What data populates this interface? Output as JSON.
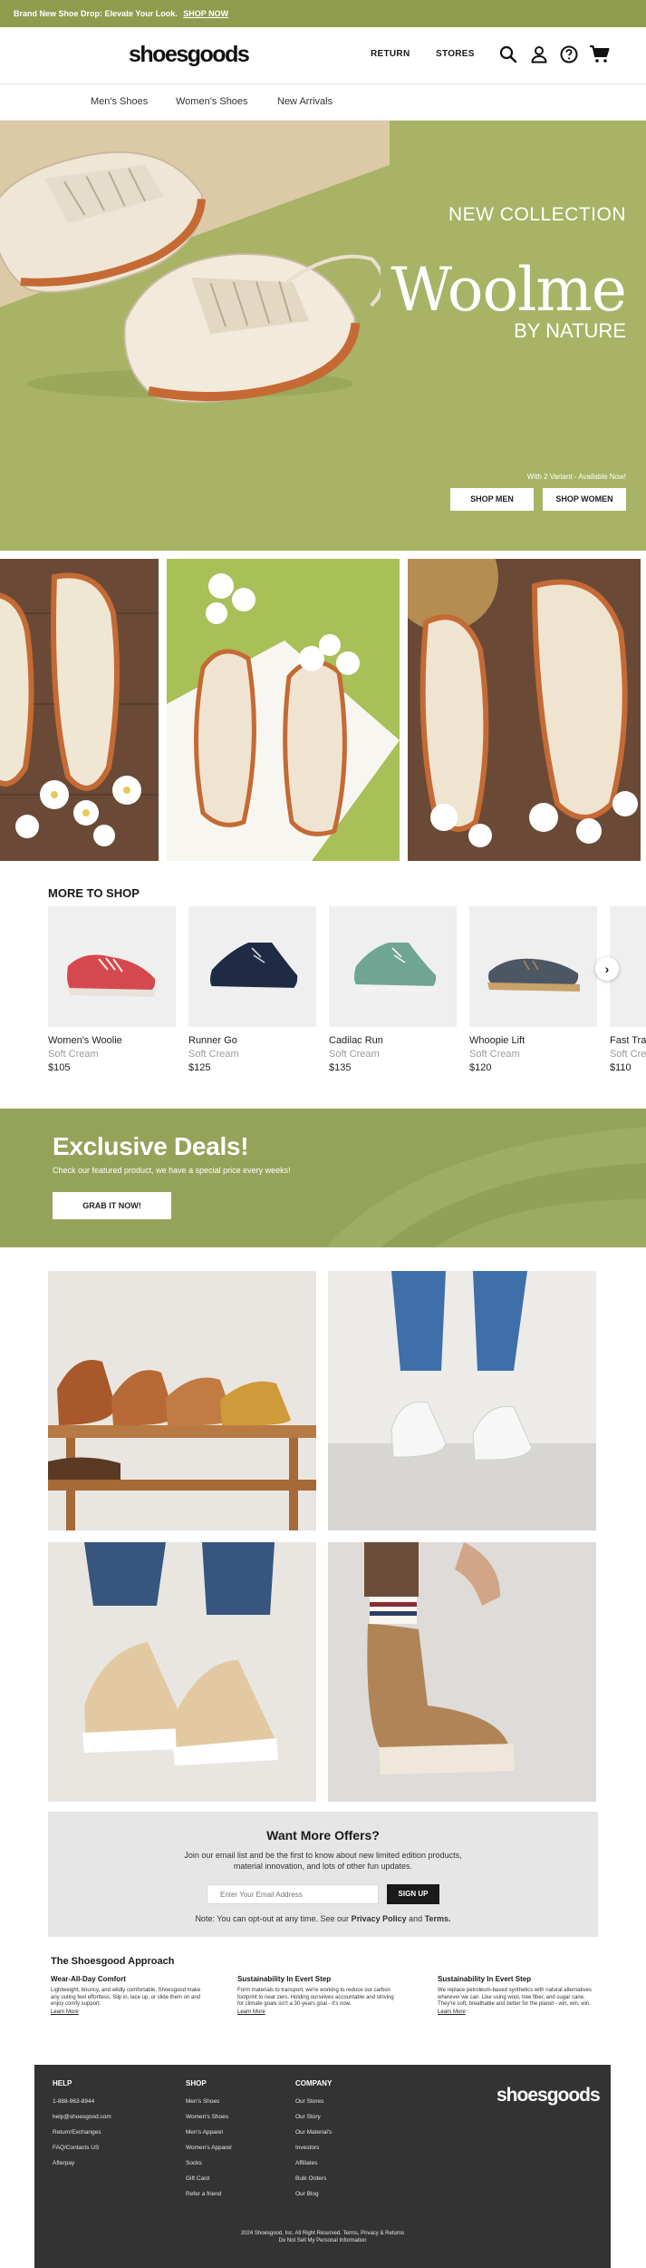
{
  "announcement": {
    "text": "Brand New Shoe Drop: Elevate Your Look.",
    "link": "SHOP NOW"
  },
  "header": {
    "logo": "shoesgoods",
    "nav": [
      "RETURN",
      "STORES"
    ],
    "icons": [
      "search-icon",
      "account-icon",
      "help-icon",
      "cart-icon"
    ]
  },
  "subnav": {
    "items": [
      "Men's Shoes",
      "Women's Shoes",
      "New Arrivals"
    ]
  },
  "hero": {
    "kicker": "NEW COLLECTION",
    "title": "Woolme",
    "subtitle": "BY NATURE",
    "variant_note": "With 2 Variant - Available Now!",
    "buttons": [
      "SHOP MEN",
      "SHOP WOMEN"
    ],
    "bg_color": "#a8b366"
  },
  "more_to_shop": {
    "title": "MORE TO SHOP",
    "products": [
      {
        "name": "Women's Woolie",
        "color": "Soft Cream",
        "price": "$105"
      },
      {
        "name": "Runner Go",
        "color": "Soft Cream",
        "price": "$125"
      },
      {
        "name": "Cadilac Run",
        "color": "Soft Cream",
        "price": "$135"
      },
      {
        "name": "Whoopie Lift",
        "color": "Soft Cream",
        "price": "$120"
      },
      {
        "name": "Fast Trai",
        "color": "Soft Cre",
        "price": "$110"
      }
    ]
  },
  "deals": {
    "title": "Exclusive Deals!",
    "subtitle": "Check our featured product, we have a special price every weeks!",
    "button": "GRAB IT NOW!"
  },
  "newsletter": {
    "title": "Want More Offers?",
    "description": "Join our email list and be the first to know about new limited edition products, material innovation, and lots of other fun updates.",
    "placeholder": "Enter Your Email Address",
    "button": "SIGN UP",
    "note_prefix": "Note: You can opt-out at any time. See our",
    "privacy": "Privacy Policy",
    "and": "and",
    "terms": "Terms."
  },
  "approach": {
    "title": "The Shoesgood Approach",
    "columns": [
      {
        "heading": "Wear-All-Day Comfort",
        "text": "Lightweight, bouncy, and wildly comfortable, Shoesgood make any outing feel effortless. Slip in, lace up, or slide them on and enjoy comfy support.",
        "link": "Learn More"
      },
      {
        "heading": "Sustainability In Evert Step",
        "text": "Form materials to transport, we're working to reduce our carbon footprint to near zero. Holding ourselves accountable and striving for climate goals isn't a 30-years goal - it's now.",
        "link": "Learn More"
      },
      {
        "heading": "Sustainability In Evert Step",
        "text": "We replace petroleum-based synthetics with natural alternatives wherever we can. Like using wool, tree fiber, and sugar cane. They're soft, breathable and better for the planet - win, win, win.",
        "link": "Learn More"
      }
    ]
  },
  "footer": {
    "logo": "shoesgoods",
    "help": {
      "title": "HELP",
      "links": [
        "1-888-963-8944",
        "help@shoesgood.com",
        "Return/Exchanges",
        "FAQ/Contacts US",
        "Afterpay"
      ]
    },
    "shop": {
      "title": "SHOP",
      "links": [
        "Men's Shoes",
        "Women's Shoes",
        "Men's Apparel",
        "Women's Apparel",
        "Socks",
        "Gift Card",
        "Refer a friend"
      ]
    },
    "company": {
      "title": "COMPANY",
      "links": [
        "Our Stores",
        "Our Story",
        "Our Material's",
        "Investors",
        "Affiliates",
        "Bulk Orders",
        "Our Blog"
      ]
    },
    "copyright": "2024 Shoesgood, Inc. All Right Reserved. Terms, Privacy & Returns",
    "do_not_sell": "Do Not Sell My Personal Information"
  }
}
